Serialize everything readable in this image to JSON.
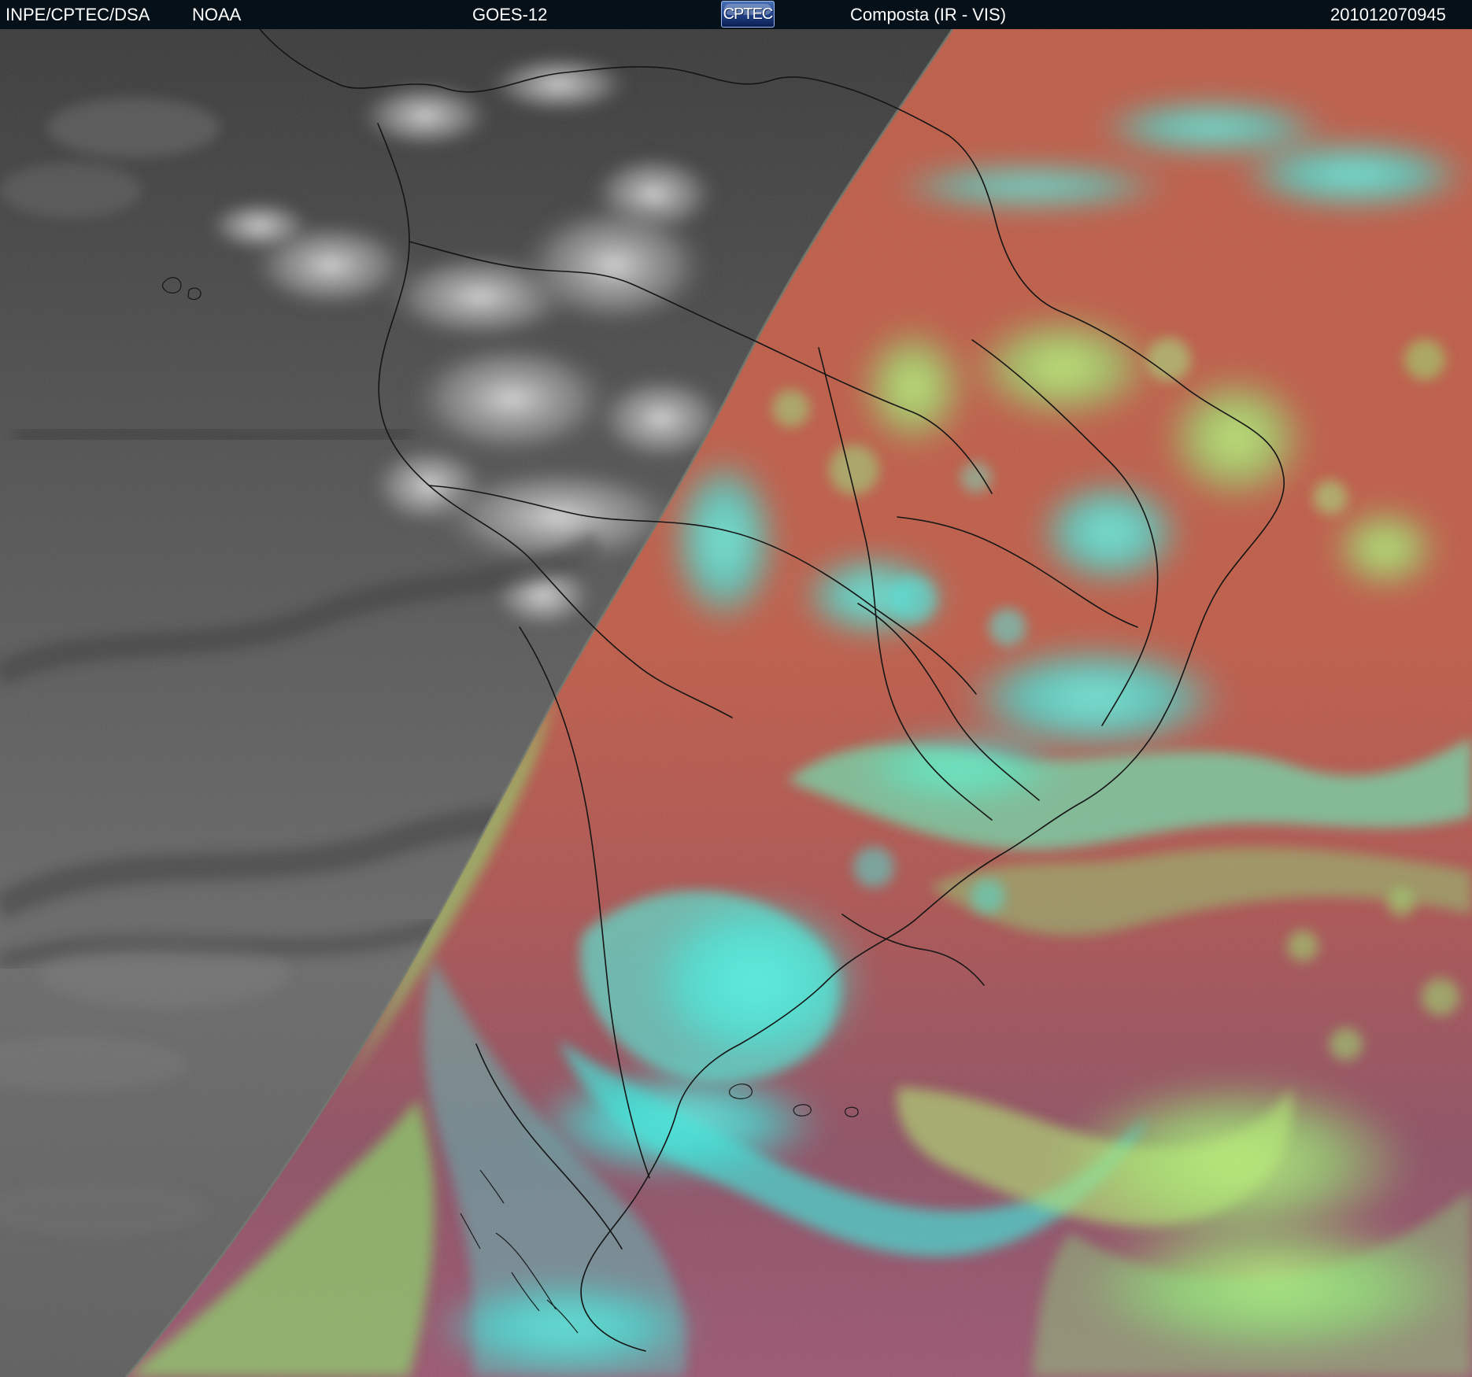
{
  "header": {
    "source": "INPE/CPTEC/DSA",
    "agency": "NOAA",
    "satellite": "GOES-12",
    "logo_text": "CPTEC",
    "product": "Composta (IR - VIS)",
    "timestamp": "201012070945"
  },
  "image": {
    "left_region": "grayscale infrared",
    "right_region": "false-color composite",
    "colors": {
      "ir_gray": "#696969",
      "composite_orange": "#c05a45",
      "composite_magenta": "#8e4f63",
      "cloud_cyan": "#40ead7",
      "cloud_green": "#96e17a",
      "boundaries": "#1f1f1f"
    }
  }
}
